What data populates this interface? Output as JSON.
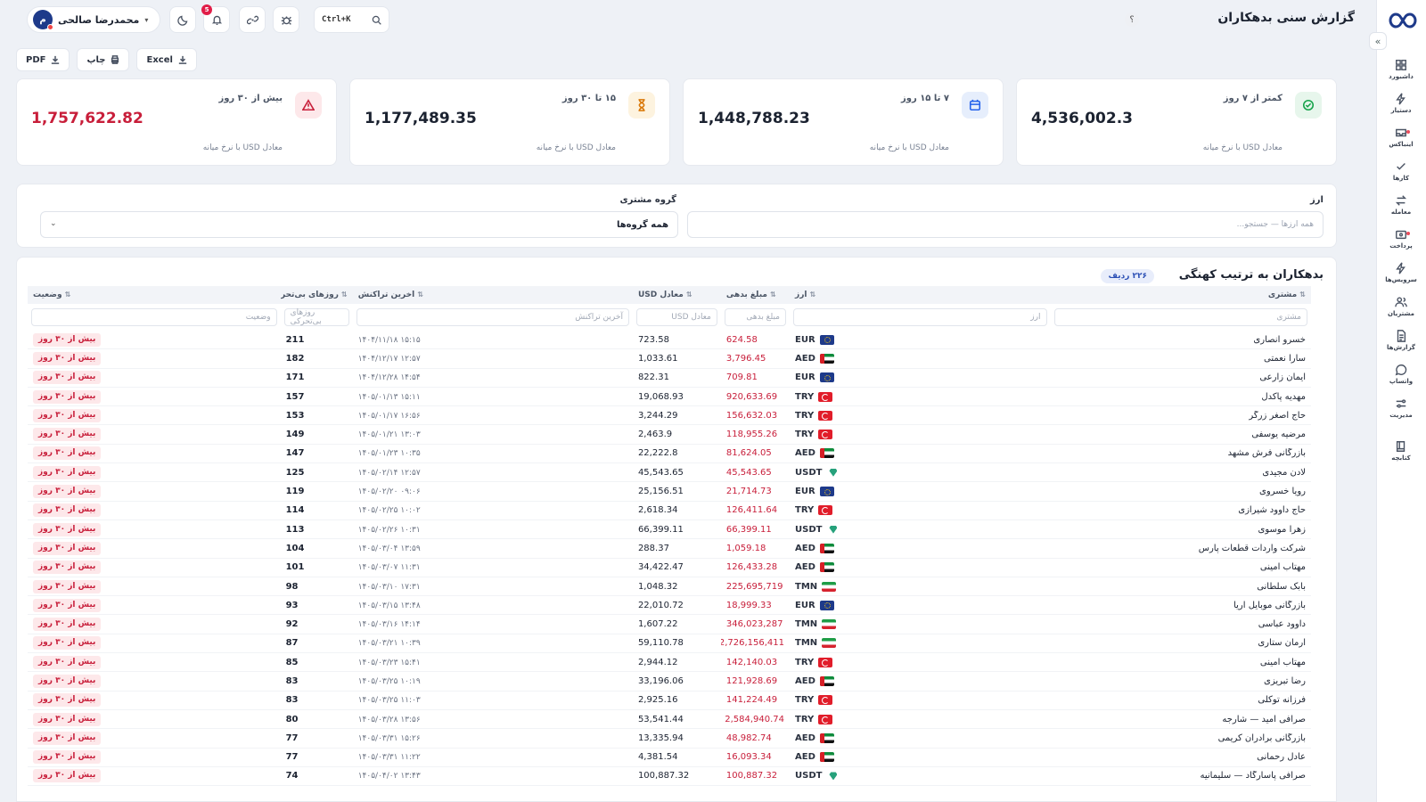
{
  "page": {
    "title": "گزارش سنی بدهکاران",
    "help": "؟"
  },
  "user": {
    "name": "محمدرضا صالحی",
    "initial": "م"
  },
  "header": {
    "shortcut": "Ctrl+K",
    "notif_count": "5"
  },
  "exports": {
    "excel": "Excel",
    "print": "چاپ",
    "pdf": "PDF"
  },
  "sidebar": {
    "items": [
      {
        "label": "داشبورد",
        "icon": "dashboard-icon"
      },
      {
        "label": "دستیار",
        "icon": "bolt-icon"
      },
      {
        "label": "اینباکس",
        "icon": "inbox-icon"
      },
      {
        "label": "کارها",
        "icon": "check-icon"
      },
      {
        "label": "معامله",
        "icon": "exchange-icon"
      },
      {
        "label": "پرداخت",
        "icon": "wallet-icon"
      },
      {
        "label": "سرویس‌ها",
        "icon": "bolt-icon"
      },
      {
        "label": "مشتریان",
        "icon": "users-icon"
      },
      {
        "label": "گزارش‌ها",
        "icon": "report-icon"
      },
      {
        "label": "واتساپ",
        "icon": "chat-icon"
      },
      {
        "label": "مدیریت",
        "icon": "sliders-icon"
      },
      {
        "label": "کتابچه",
        "icon": "book-icon"
      }
    ]
  },
  "kpis": [
    {
      "label": "کمتر از ۷ روز",
      "value": "4,536,002.3",
      "sub": "معادل USD با نرخ میانه",
      "icon": "check-circle-icon",
      "tone": "green"
    },
    {
      "label": "۷ تا ۱۵ روز",
      "value": "1,448,788.23",
      "sub": "معادل USD با نرخ میانه",
      "icon": "calendar-icon",
      "tone": "blue"
    },
    {
      "label": "۱۵ تا ۳۰ روز",
      "value": "1,177,489.35",
      "sub": "معادل USD با نرخ میانه",
      "icon": "hourglass-icon",
      "tone": "amber"
    },
    {
      "label": "بیش از ۳۰ روز",
      "value": "1,757,622.82",
      "sub": "معادل USD با نرخ میانه",
      "icon": "warning-icon",
      "tone": "red"
    }
  ],
  "filters": {
    "currency_label": "ارز",
    "currency_placeholder": "همه ارزها — جستجو...",
    "group_label": "گروه مشتری",
    "group_value": "همه گروه‌ها"
  },
  "table": {
    "title": "بدهکاران به ترتیب کهنگی",
    "count": "۲۲۶ ردیف",
    "columns": {
      "customer": "مشتری",
      "currency": "ارز",
      "amount": "مبلغ بدهی",
      "usd": "معادل USD",
      "last": "آخرین تراکنش",
      "days": "روزهای بی‌تحرکی",
      "status": "وضعیت"
    },
    "filter_placeholders": {
      "customer": "مشتری",
      "currency": "ارز",
      "amount": "مبلغ بدهی",
      "usd": "معادل USD",
      "last": "آخرین تراکنش",
      "days": "روزهای بی‌تحرکی",
      "status": "وضعیت"
    },
    "sort_glyph": "⇅",
    "rows": [
      {
        "customer": "خسرو انصاری",
        "currency": "EUR",
        "amount": "624.58",
        "usd": "723.58",
        "last": "۱۴۰۴/۱۱/۱۸ ۱۵:۱۵",
        "days": "211",
        "status": "بیش از ۳۰ روز"
      },
      {
        "customer": "سارا نعمتی",
        "currency": "AED",
        "amount": "3,796.45",
        "usd": "1,033.61",
        "last": "۱۴۰۴/۱۲/۱۷ ۱۲:۵۷",
        "days": "182",
        "status": "بیش از ۳۰ روز"
      },
      {
        "customer": "ایمان زارعی",
        "currency": "EUR",
        "amount": "709.81",
        "usd": "822.31",
        "last": "۱۴۰۴/۱۲/۲۸ ۱۴:۵۴",
        "days": "171",
        "status": "بیش از ۳۰ روز"
      },
      {
        "customer": "مهدیه پاکدل",
        "currency": "TRY",
        "amount": "920,633.69",
        "usd": "19,068.93",
        "last": "۱۴۰۵/۰۱/۱۳ ۱۵:۱۱",
        "days": "157",
        "status": "بیش از ۳۰ روز"
      },
      {
        "customer": "حاج اصغر زرگر",
        "currency": "TRY",
        "amount": "156,632.03",
        "usd": "3,244.29",
        "last": "۱۴۰۵/۰۱/۱۷ ۱۶:۵۶",
        "days": "153",
        "status": "بیش از ۳۰ روز"
      },
      {
        "customer": "مرضیه یوسفی",
        "currency": "TRY",
        "amount": "118,955.26",
        "usd": "2,463.9",
        "last": "۱۴۰۵/۰۱/۲۱ ۱۳:۰۳",
        "days": "149",
        "status": "بیش از ۳۰ روز"
      },
      {
        "customer": "بازرگانی فرش مشهد",
        "currency": "AED",
        "amount": "81,624.05",
        "usd": "22,222.8",
        "last": "۱۴۰۵/۰۱/۲۳ ۱۰:۳۵",
        "days": "147",
        "status": "بیش از ۳۰ روز"
      },
      {
        "customer": "لادن مجیدی",
        "currency": "USDT",
        "amount": "45,543.65",
        "usd": "45,543.65",
        "last": "۱۴۰۵/۰۲/۱۴ ۱۲:۵۷",
        "days": "125",
        "status": "بیش از ۳۰ روز"
      },
      {
        "customer": "رویا خسروی",
        "currency": "EUR",
        "amount": "21,714.73",
        "usd": "25,156.51",
        "last": "۱۴۰۵/۰۲/۲۰ ۰۹:۰۶",
        "days": "119",
        "status": "بیش از ۳۰ روز"
      },
      {
        "customer": "حاج داوود شیرازی",
        "currency": "TRY",
        "amount": "126,411.64",
        "usd": "2,618.34",
        "last": "۱۴۰۵/۰۲/۲۵ ۱۰:۰۲",
        "days": "114",
        "status": "بیش از ۳۰ روز"
      },
      {
        "customer": "زهرا موسوی",
        "currency": "USDT",
        "amount": "66,399.11",
        "usd": "66,399.11",
        "last": "۱۴۰۵/۰۲/۲۶ ۱۰:۳۱",
        "days": "113",
        "status": "بیش از ۳۰ روز"
      },
      {
        "customer": "شرکت واردات قطعات پارس",
        "currency": "AED",
        "amount": "1,059.18",
        "usd": "288.37",
        "last": "۱۴۰۵/۰۳/۰۴ ۱۳:۵۹",
        "days": "104",
        "status": "بیش از ۳۰ روز"
      },
      {
        "customer": "مهتاب امینی",
        "currency": "AED",
        "amount": "126,433.28",
        "usd": "34,422.47",
        "last": "۱۴۰۵/۰۳/۰۷ ۱۱:۳۱",
        "days": "101",
        "status": "بیش از ۳۰ روز"
      },
      {
        "customer": "بابک سلطانی",
        "currency": "TMN",
        "amount": "225,695,719",
        "usd": "1,048.32",
        "last": "۱۴۰۵/۰۳/۱۰ ۱۷:۳۱",
        "days": "98",
        "status": "بیش از ۳۰ روز"
      },
      {
        "customer": "بازرگانی موبایل آریا",
        "currency": "EUR",
        "amount": "18,999.33",
        "usd": "22,010.72",
        "last": "۱۴۰۵/۰۳/۱۵ ۱۳:۴۸",
        "days": "93",
        "status": "بیش از ۳۰ روز"
      },
      {
        "customer": "داوود عباسی",
        "currency": "TMN",
        "amount": "346,023,287",
        "usd": "1,607.22",
        "last": "۱۴۰۵/۰۳/۱۶ ۱۴:۱۴",
        "days": "92",
        "status": "بیش از ۳۰ روز"
      },
      {
        "customer": "آرمان ستاری",
        "currency": "TMN",
        "amount": "12,726,156,411",
        "usd": "59,110.78",
        "last": "۱۴۰۵/۰۳/۲۱ ۱۰:۳۹",
        "days": "87",
        "status": "بیش از ۳۰ روز"
      },
      {
        "customer": "مهتاب امینی",
        "currency": "TRY",
        "amount": "142,140.03",
        "usd": "2,944.12",
        "last": "۱۴۰۵/۰۳/۲۳ ۱۵:۴۱",
        "days": "85",
        "status": "بیش از ۳۰ روز"
      },
      {
        "customer": "رضا تبریزی",
        "currency": "AED",
        "amount": "121,928.69",
        "usd": "33,196.06",
        "last": "۱۴۰۵/۰۳/۲۵ ۱۰:۱۹",
        "days": "83",
        "status": "بیش از ۳۰ روز"
      },
      {
        "customer": "فرزانه توکلی",
        "currency": "TRY",
        "amount": "141,224.49",
        "usd": "2,925.16",
        "last": "۱۴۰۵/۰۳/۲۵ ۱۱:۰۳",
        "days": "83",
        "status": "بیش از ۳۰ روز"
      },
      {
        "customer": "صرافی امید — شارجه",
        "currency": "TRY",
        "amount": "2,584,940.74",
        "usd": "53,541.44",
        "last": "۱۴۰۵/۰۳/۲۸ ۱۳:۵۶",
        "days": "80",
        "status": "بیش از ۳۰ روز"
      },
      {
        "customer": "بازرگانی برادران کریمی",
        "currency": "AED",
        "amount": "48,982.74",
        "usd": "13,335.94",
        "last": "۱۴۰۵/۰۳/۳۱ ۱۵:۲۶",
        "days": "77",
        "status": "بیش از ۳۰ روز"
      },
      {
        "customer": "عادل رحمانی",
        "currency": "AED",
        "amount": "16,093.34",
        "usd": "4,381.54",
        "last": "۱۴۰۵/۰۳/۳۱ ۱۱:۲۲",
        "days": "77",
        "status": "بیش از ۳۰ روز"
      },
      {
        "customer": "صرافی پاسارگاد — سلیمانیه",
        "currency": "USDT",
        "amount": "100,887.32",
        "usd": "100,887.32",
        "last": "۱۴۰۵/۰۴/۰۲ ۱۳:۴۳",
        "days": "74",
        "status": "بیش از ۳۰ روز"
      }
    ]
  },
  "colors": {
    "accent": "#2b4fb5",
    "danger": "#c81e3a",
    "green": "#16a34a",
    "amber": "#d97706",
    "blue": "#2563eb"
  }
}
